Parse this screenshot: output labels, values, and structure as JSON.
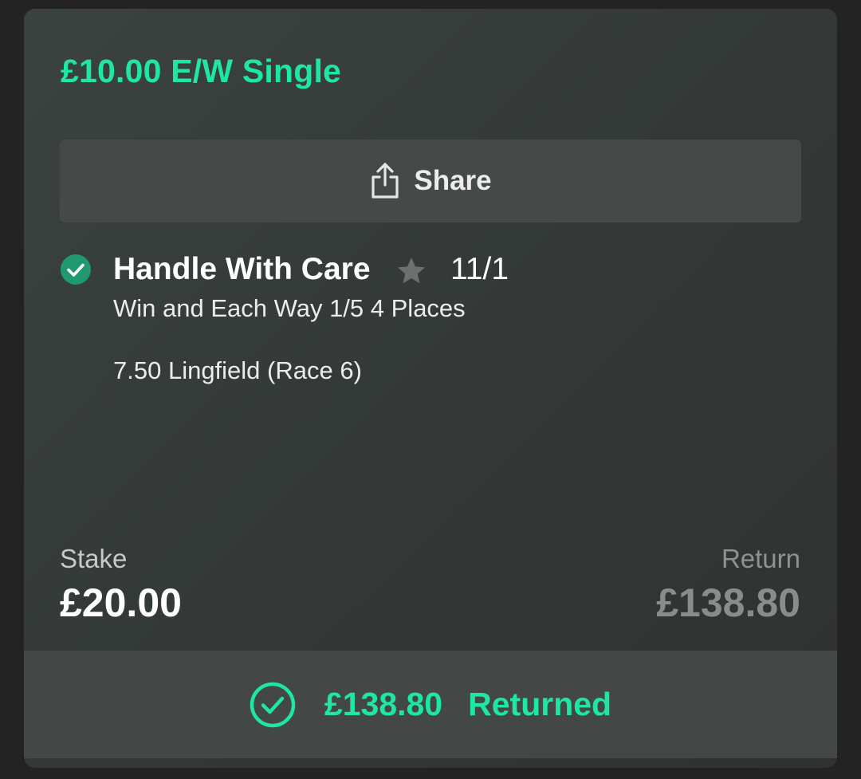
{
  "bet": {
    "title": "£10.00 E/W Single"
  },
  "actions": {
    "share_label": "Share",
    "share_icon": "share-icon"
  },
  "selection": {
    "status_icon": "check-circle-icon",
    "name": "Handle With Care",
    "favourite_icon": "star-icon",
    "odds": "11/1",
    "market": "Win and Each Way 1/5 4 Places",
    "event": "7.50 Lingfield (Race 6)"
  },
  "totals": {
    "stake_label": "Stake",
    "stake_value": "£20.00",
    "return_label": "Return",
    "return_value": "£138.80"
  },
  "result": {
    "icon": "check-circle-outline-icon",
    "amount": "£138.80",
    "label": "Returned"
  },
  "colors": {
    "accent": "#1ee6a3",
    "check_green": "#1f9a70",
    "card_bg": "#373c3a",
    "button_bg": "#454a48"
  }
}
